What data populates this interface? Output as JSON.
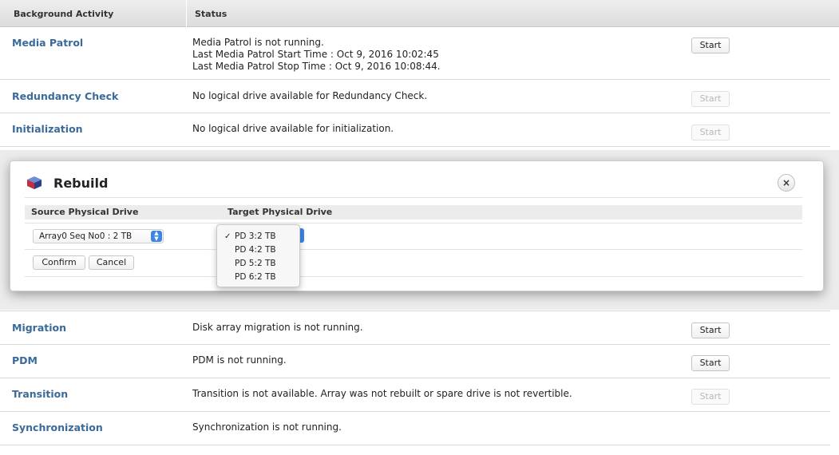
{
  "header": {
    "col_activity": "Background Activity",
    "col_status": "Status"
  },
  "rows_top": [
    {
      "name": "Media Patrol",
      "status": [
        "Media Patrol is not running.",
        "Last Media Patrol Start Time : Oct 9, 2016 10:02:45",
        "Last Media Patrol Stop Time : Oct 9, 2016 10:08:44."
      ],
      "button": "Start",
      "enabled": true
    },
    {
      "name": "Redundancy Check",
      "status": [
        "No logical drive available for Redundancy Check."
      ],
      "button": "Start",
      "enabled": false
    },
    {
      "name": "Initialization",
      "status": [
        "No logical drive available for initialization."
      ],
      "button": "Start",
      "enabled": false
    }
  ],
  "dialog": {
    "title": "Rebuild",
    "close_symbol": "×",
    "col_source": "Source Physical Drive",
    "col_target": "Target Physical Drive",
    "source_value": "Array0 Seq No0 : 2 TB",
    "confirm_label": "Confirm",
    "cancel_label": "Cancel",
    "target_options": [
      "PD 3:2 TB",
      "PD 4:2 TB",
      "PD 5:2 TB",
      "PD 6:2 TB"
    ],
    "target_selected": "PD 3:2 TB",
    "check_symbol": "✓"
  },
  "rows_bottom": [
    {
      "name": "Migration",
      "status": [
        "Disk array migration is not running."
      ],
      "button": "Start",
      "enabled": true
    },
    {
      "name": "PDM",
      "status": [
        "PDM is not running."
      ],
      "button": "Start",
      "enabled": true
    },
    {
      "name": "Transition",
      "status": [
        "Transition is not available. Array was not rebuilt or spare drive is not revertible."
      ],
      "button": "Start",
      "enabled": false
    },
    {
      "name": "Synchronization",
      "status": [
        "Synchronization is not running."
      ],
      "button": "",
      "enabled": false
    }
  ],
  "colors": {
    "link": "#3a6a9a",
    "select_accent": "#3d86e5"
  },
  "icons": {
    "dialog": "rebuild-cube-icon",
    "close": "close-icon",
    "select": "select-arrows-icon"
  }
}
